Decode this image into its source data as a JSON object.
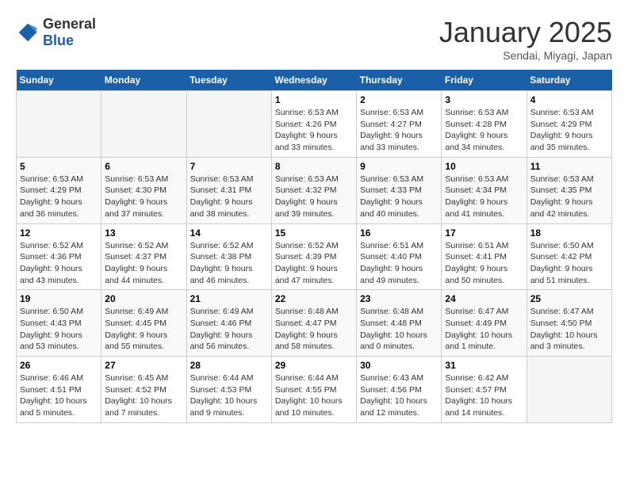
{
  "logo": {
    "general": "General",
    "blue": "Blue"
  },
  "title": "January 2025",
  "location": "Sendai, Miyagi, Japan",
  "weekdays": [
    "Sunday",
    "Monday",
    "Tuesday",
    "Wednesday",
    "Thursday",
    "Friday",
    "Saturday"
  ],
  "weeks": [
    [
      {
        "day": "",
        "sunrise": "",
        "sunset": "",
        "daylight": ""
      },
      {
        "day": "",
        "sunrise": "",
        "sunset": "",
        "daylight": ""
      },
      {
        "day": "",
        "sunrise": "",
        "sunset": "",
        "daylight": ""
      },
      {
        "day": "1",
        "sunrise": "Sunrise: 6:53 AM",
        "sunset": "Sunset: 4:26 PM",
        "daylight": "Daylight: 9 hours and 33 minutes."
      },
      {
        "day": "2",
        "sunrise": "Sunrise: 6:53 AM",
        "sunset": "Sunset: 4:27 PM",
        "daylight": "Daylight: 9 hours and 33 minutes."
      },
      {
        "day": "3",
        "sunrise": "Sunrise: 6:53 AM",
        "sunset": "Sunset: 4:28 PM",
        "daylight": "Daylight: 9 hours and 34 minutes."
      },
      {
        "day": "4",
        "sunrise": "Sunrise: 6:53 AM",
        "sunset": "Sunset: 4:29 PM",
        "daylight": "Daylight: 9 hours and 35 minutes."
      }
    ],
    [
      {
        "day": "5",
        "sunrise": "Sunrise: 6:53 AM",
        "sunset": "Sunset: 4:29 PM",
        "daylight": "Daylight: 9 hours and 36 minutes."
      },
      {
        "day": "6",
        "sunrise": "Sunrise: 6:53 AM",
        "sunset": "Sunset: 4:30 PM",
        "daylight": "Daylight: 9 hours and 37 minutes."
      },
      {
        "day": "7",
        "sunrise": "Sunrise: 6:53 AM",
        "sunset": "Sunset: 4:31 PM",
        "daylight": "Daylight: 9 hours and 38 minutes."
      },
      {
        "day": "8",
        "sunrise": "Sunrise: 6:53 AM",
        "sunset": "Sunset: 4:32 PM",
        "daylight": "Daylight: 9 hours and 39 minutes."
      },
      {
        "day": "9",
        "sunrise": "Sunrise: 6:53 AM",
        "sunset": "Sunset: 4:33 PM",
        "daylight": "Daylight: 9 hours and 40 minutes."
      },
      {
        "day": "10",
        "sunrise": "Sunrise: 6:53 AM",
        "sunset": "Sunset: 4:34 PM",
        "daylight": "Daylight: 9 hours and 41 minutes."
      },
      {
        "day": "11",
        "sunrise": "Sunrise: 6:53 AM",
        "sunset": "Sunset: 4:35 PM",
        "daylight": "Daylight: 9 hours and 42 minutes."
      }
    ],
    [
      {
        "day": "12",
        "sunrise": "Sunrise: 6:52 AM",
        "sunset": "Sunset: 4:36 PM",
        "daylight": "Daylight: 9 hours and 43 minutes."
      },
      {
        "day": "13",
        "sunrise": "Sunrise: 6:52 AM",
        "sunset": "Sunset: 4:37 PM",
        "daylight": "Daylight: 9 hours and 44 minutes."
      },
      {
        "day": "14",
        "sunrise": "Sunrise: 6:52 AM",
        "sunset": "Sunset: 4:38 PM",
        "daylight": "Daylight: 9 hours and 46 minutes."
      },
      {
        "day": "15",
        "sunrise": "Sunrise: 6:52 AM",
        "sunset": "Sunset: 4:39 PM",
        "daylight": "Daylight: 9 hours and 47 minutes."
      },
      {
        "day": "16",
        "sunrise": "Sunrise: 6:51 AM",
        "sunset": "Sunset: 4:40 PM",
        "daylight": "Daylight: 9 hours and 49 minutes."
      },
      {
        "day": "17",
        "sunrise": "Sunrise: 6:51 AM",
        "sunset": "Sunset: 4:41 PM",
        "daylight": "Daylight: 9 hours and 50 minutes."
      },
      {
        "day": "18",
        "sunrise": "Sunrise: 6:50 AM",
        "sunset": "Sunset: 4:42 PM",
        "daylight": "Daylight: 9 hours and 51 minutes."
      }
    ],
    [
      {
        "day": "19",
        "sunrise": "Sunrise: 6:50 AM",
        "sunset": "Sunset: 4:43 PM",
        "daylight": "Daylight: 9 hours and 53 minutes."
      },
      {
        "day": "20",
        "sunrise": "Sunrise: 6:49 AM",
        "sunset": "Sunset: 4:45 PM",
        "daylight": "Daylight: 9 hours and 55 minutes."
      },
      {
        "day": "21",
        "sunrise": "Sunrise: 6:49 AM",
        "sunset": "Sunset: 4:46 PM",
        "daylight": "Daylight: 9 hours and 56 minutes."
      },
      {
        "day": "22",
        "sunrise": "Sunrise: 6:48 AM",
        "sunset": "Sunset: 4:47 PM",
        "daylight": "Daylight: 9 hours and 58 minutes."
      },
      {
        "day": "23",
        "sunrise": "Sunrise: 6:48 AM",
        "sunset": "Sunset: 4:48 PM",
        "daylight": "Daylight: 10 hours and 0 minutes."
      },
      {
        "day": "24",
        "sunrise": "Sunrise: 6:47 AM",
        "sunset": "Sunset: 4:49 PM",
        "daylight": "Daylight: 10 hours and 1 minute."
      },
      {
        "day": "25",
        "sunrise": "Sunrise: 6:47 AM",
        "sunset": "Sunset: 4:50 PM",
        "daylight": "Daylight: 10 hours and 3 minutes."
      }
    ],
    [
      {
        "day": "26",
        "sunrise": "Sunrise: 6:46 AM",
        "sunset": "Sunset: 4:51 PM",
        "daylight": "Daylight: 10 hours and 5 minutes."
      },
      {
        "day": "27",
        "sunrise": "Sunrise: 6:45 AM",
        "sunset": "Sunset: 4:52 PM",
        "daylight": "Daylight: 10 hours and 7 minutes."
      },
      {
        "day": "28",
        "sunrise": "Sunrise: 6:44 AM",
        "sunset": "Sunset: 4:53 PM",
        "daylight": "Daylight: 10 hours and 9 minutes."
      },
      {
        "day": "29",
        "sunrise": "Sunrise: 6:44 AM",
        "sunset": "Sunset: 4:55 PM",
        "daylight": "Daylight: 10 hours and 10 minutes."
      },
      {
        "day": "30",
        "sunrise": "Sunrise: 6:43 AM",
        "sunset": "Sunset: 4:56 PM",
        "daylight": "Daylight: 10 hours and 12 minutes."
      },
      {
        "day": "31",
        "sunrise": "Sunrise: 6:42 AM",
        "sunset": "Sunset: 4:57 PM",
        "daylight": "Daylight: 10 hours and 14 minutes."
      },
      {
        "day": "",
        "sunrise": "",
        "sunset": "",
        "daylight": ""
      }
    ]
  ]
}
